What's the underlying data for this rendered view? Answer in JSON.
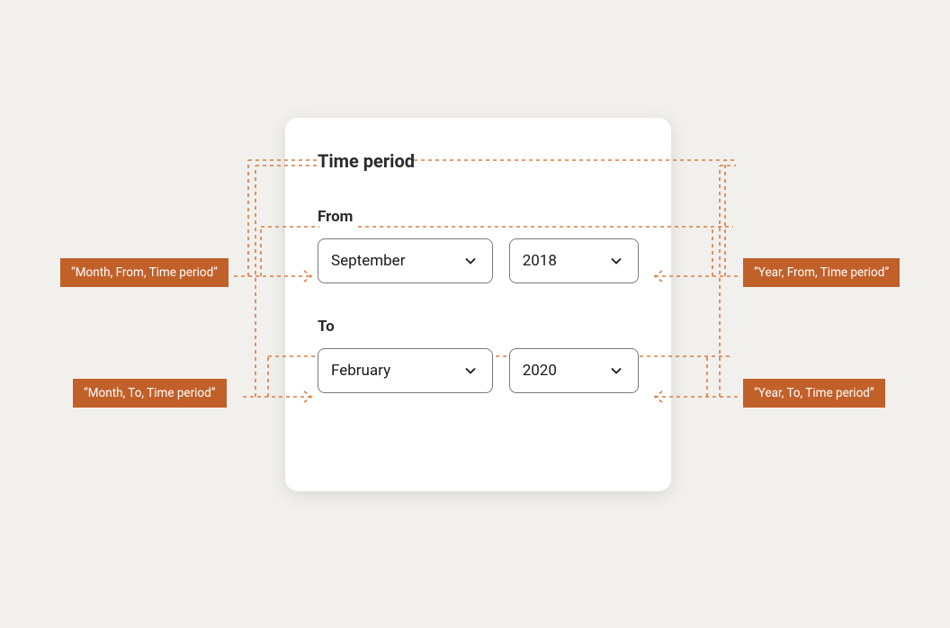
{
  "card": {
    "title": "Time period",
    "from": {
      "label": "From",
      "month": "September",
      "year": "2018"
    },
    "to": {
      "label": "To",
      "month": "February",
      "year": "2020"
    }
  },
  "annotations": {
    "month_from": "“Month, From, Time period”",
    "year_from": "“Year, From, Time period”",
    "month_to": "“Month, To, Time period”",
    "year_to": "“Year, To, Time period”"
  },
  "colors": {
    "accent": "#c2602a",
    "dashed": "#d97b3f"
  }
}
